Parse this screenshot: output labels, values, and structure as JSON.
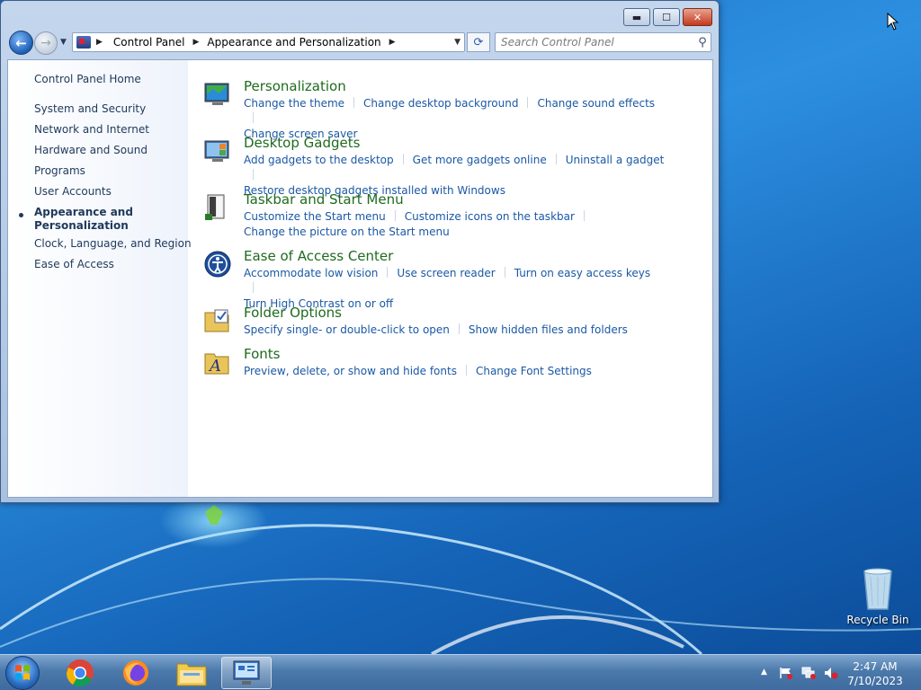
{
  "window": {
    "buttons": {
      "minimize": "▬",
      "maximize": "☐",
      "close": "✕"
    }
  },
  "navigation": {
    "breadcrumb": [
      "Control Panel",
      "Appearance and Personalization"
    ],
    "search_placeholder": "Search Control Panel"
  },
  "sidebar": {
    "items": [
      {
        "label": "Control Panel Home",
        "active": false
      },
      {
        "label": "System and Security",
        "active": false
      },
      {
        "label": "Network and Internet",
        "active": false
      },
      {
        "label": "Hardware and Sound",
        "active": false
      },
      {
        "label": "Programs",
        "active": false
      },
      {
        "label": "User Accounts",
        "active": false
      },
      {
        "label": "Appearance and Personalization",
        "active": true
      },
      {
        "label": "Clock, Language, and Region",
        "active": false
      },
      {
        "label": "Ease of Access",
        "active": false
      }
    ]
  },
  "categories": [
    {
      "title": "Personalization",
      "icon": "personalization-icon",
      "links": [
        "Change the theme",
        "Change desktop background",
        "Change sound effects",
        "Change screen saver"
      ]
    },
    {
      "title": "Desktop Gadgets",
      "icon": "desktop-gadgets-icon",
      "links": [
        "Add gadgets to the desktop",
        "Get more gadgets online",
        "Uninstall a gadget",
        "Restore desktop gadgets installed with Windows"
      ]
    },
    {
      "title": "Taskbar and Start Menu",
      "icon": "taskbar-icon",
      "links": [
        "Customize the Start menu",
        "Customize icons on the taskbar",
        "Change the picture on the Start menu"
      ]
    },
    {
      "title": "Ease of Access Center",
      "icon": "ease-of-access-icon",
      "links": [
        "Accommodate low vision",
        "Use screen reader",
        "Turn on easy access keys",
        "Turn High Contrast on or off"
      ]
    },
    {
      "title": "Folder Options",
      "icon": "folder-options-icon",
      "links": [
        "Specify single- or double-click to open",
        "Show hidden files and folders"
      ]
    },
    {
      "title": "Fonts",
      "icon": "fonts-icon",
      "links": [
        "Preview, delete, or show and hide fonts",
        "Change Font Settings"
      ]
    }
  ],
  "desktop": {
    "recycle_bin_label": "Recycle Bin"
  },
  "taskbar": {
    "apps": [
      "chrome-icon",
      "firefox-icon",
      "file-explorer-icon",
      "control-panel-icon"
    ],
    "clock_time": "2:47 AM",
    "clock_date": "7/10/2023"
  }
}
